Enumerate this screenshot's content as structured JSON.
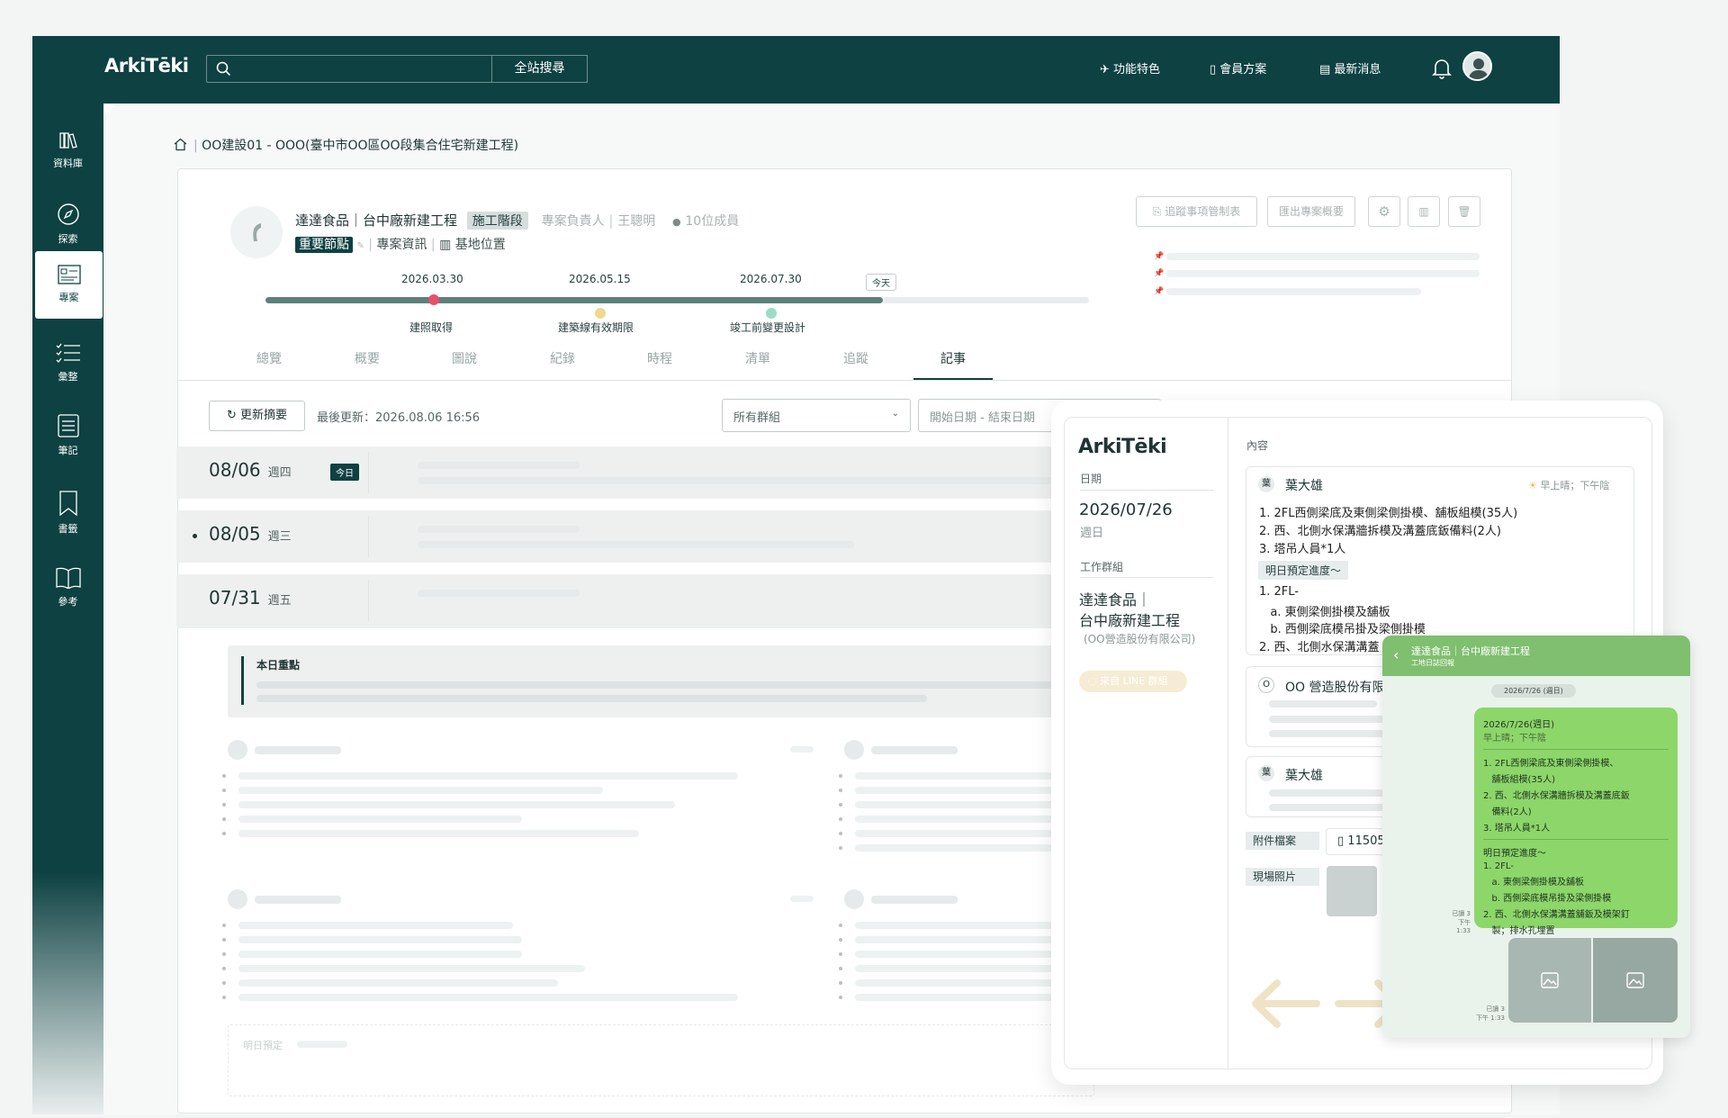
{
  "topbar": {
    "logo": "ArkiTēki",
    "search_placeholder": "",
    "search_button": "全站搜尋",
    "nav": [
      "功能特色",
      "會員方案",
      "最新消息"
    ]
  },
  "sidebar": {
    "items": [
      {
        "label": "資料庫",
        "icon": "library-icon"
      },
      {
        "label": "探索",
        "icon": "compass-icon"
      },
      {
        "label": "專案",
        "icon": "project-icon",
        "active": true
      },
      {
        "label": "彙整",
        "icon": "checklist-icon"
      },
      {
        "label": "筆記",
        "icon": "note-icon"
      },
      {
        "label": "書籤",
        "icon": "bookmark-icon"
      },
      {
        "label": "參考",
        "icon": "book-icon"
      }
    ]
  },
  "breadcrumb": "OO建設01 - OOO(臺中市OO區OO段集合住宅新建工程)",
  "project": {
    "name": "達達食品｜台中廠新建工程",
    "stage": "施工階段",
    "manager_label": "專案負責人",
    "manager": "王聰明",
    "members": "10位成員",
    "tag": "重要節點",
    "info_link": "專案資訊",
    "site_link": "基地位置",
    "actions": [
      "追蹤事項管制表",
      "匯出專案概要"
    ]
  },
  "timeline": {
    "today_label": "今天",
    "milestones": [
      {
        "date": "2026.03.30",
        "label": "建照取得",
        "color": "#e8506a"
      },
      {
        "date": "2026.05.15",
        "label": "建築線有效期限",
        "color": "#f0d98a"
      },
      {
        "date": "2026.07.30",
        "label": "竣工前變更設計",
        "color": "#9bdcc6"
      }
    ]
  },
  "tabs": [
    "總覽",
    "概要",
    "圖說",
    "紀錄",
    "時程",
    "清單",
    "追蹤",
    "記事"
  ],
  "active_tab": "記事",
  "toolbar": {
    "refresh": "更新摘要",
    "last_update": "最後更新：2026.08.06 16:56",
    "group_select": "所有群組",
    "date_range": "開始日期 - 結束日期"
  },
  "entries": [
    {
      "date": "08/06",
      "weekday": "週四",
      "badge": "今日"
    },
    {
      "date": "08/05",
      "weekday": "週三"
    },
    {
      "date": "07/31",
      "weekday": "週五"
    }
  ],
  "today_focus": "本日重點",
  "tomorrow": "明日預定",
  "detail": {
    "logo": "ArkiTēki",
    "date_label": "日期",
    "date": "2026/07/26",
    "weekday": "週日",
    "group_label": "工作群組",
    "group_line1": "達達食品｜",
    "group_line2": "台中廠新建工程",
    "group_company": "(OO營造股份有限公司)",
    "source_badge": "來自 LINE 群組",
    "content_label": "內容",
    "author1_initial": "葉",
    "author1": "葉大雄",
    "weather": "早上晴；下午陰",
    "lines": [
      "1. 2FL西側梁底及東側梁側掛模、舖板組模(35人)",
      "2. 西、北側水保溝牆拆模及溝蓋底鈑備料(2人)",
      "3. 塔吊人員*1人"
    ],
    "next_tag": "明日預定進度～",
    "next_lines": [
      "1. 2FL-",
      "   a. 東側梁側掛模及舖板",
      "   b. 西側梁底模吊掛及梁側掛模",
      "2. 西、北側水保溝溝蓋"
    ],
    "author2_initial": "O",
    "author2": "OO 營造股份有限",
    "author3_initial": "葉",
    "author3": "葉大雄",
    "attach_label": "附件檔案",
    "attach_file": "11505",
    "photo_label": "現場照片"
  },
  "line_chat": {
    "title": "達達食品｜台中廠新建工程",
    "subtitle": "工地日誌回報",
    "date_chip": "2026/7/26 (週日)",
    "read1": "已讀 3",
    "time1": "下午 1:33",
    "read2": "已讀 3",
    "time2": "下午 1:33",
    "bubble": [
      "2026/7/26(週日)",
      "早上晴；下午陰",
      "1. 2FL西側梁底及東側梁側掛模、",
      "   舖板組模(35人)",
      "2. 西、北側水保溝牆拆模及溝蓋底鈑",
      "   備料(2人)",
      "3. 塔吊人員*1人",
      "明日預定進度～",
      "1. 2FL-",
      "   a. 東側梁側掛模及舖板",
      "   b. 西側梁底模吊掛及梁側掛模",
      "2. 西、北側水保溝溝蓋舖鈑及模架釘",
      "   製；排水孔埋置"
    ]
  },
  "colors": {
    "brand": "#0e4142",
    "line_green": "#8dd66a",
    "arrow": "#efe3c6"
  }
}
